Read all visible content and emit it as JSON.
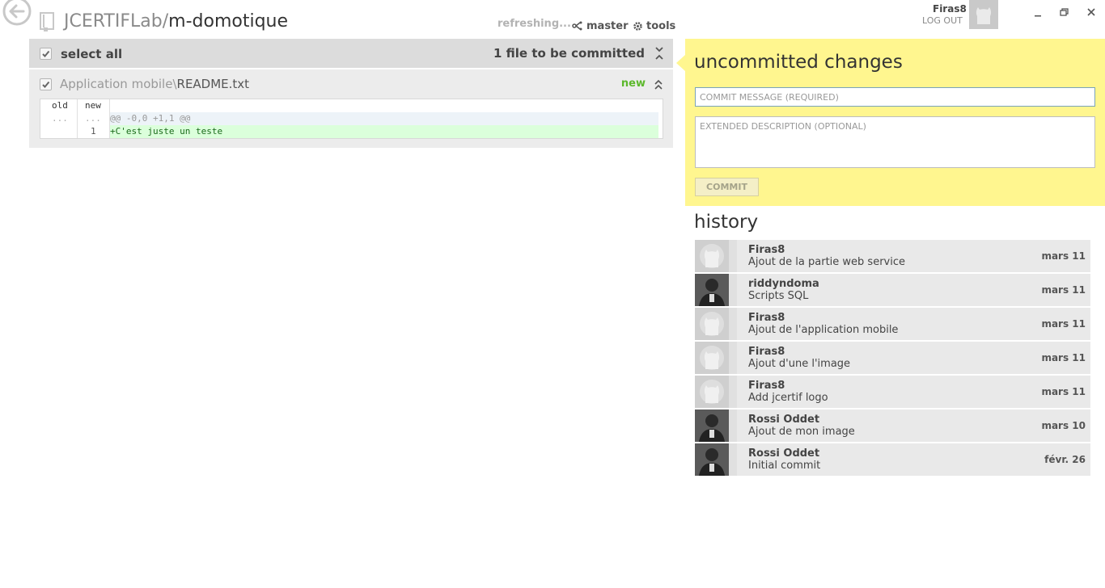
{
  "repo": {
    "owner": "JCERTIFLab",
    "separator": "/",
    "name": "m-domotique"
  },
  "toolbar": {
    "status": "refreshing...",
    "branch": "master",
    "tools": "tools"
  },
  "user": {
    "name": "Firas8",
    "logout": "LOG OUT"
  },
  "changes": {
    "select_all": "select all",
    "count_label": "1 file to be committed",
    "file": {
      "folder": "Application mobile\\",
      "name": "README.txt",
      "status": "new",
      "status_color": "#5cb82c",
      "diff": {
        "old_header": "old",
        "new_header": "new",
        "hunk_old": "...",
        "hunk_new": "...",
        "hunk_text": "@@ -0,0 +1,1 @@",
        "add_line_num": "1",
        "add_text": "+C'est juste un teste"
      }
    }
  },
  "commit_panel": {
    "title": "uncommitted changes",
    "message_placeholder": "COMMIT MESSAGE (REQUIRED)",
    "description_placeholder": "EXTENDED DESCRIPTION (OPTIONAL)",
    "commit_button": "COMMIT",
    "panel_color": "#fff68f"
  },
  "history": {
    "title": "history",
    "items": [
      {
        "author": "Firas8",
        "message": "Ajout de la partie web service",
        "date": "mars 11",
        "avatar": "octocat-icon"
      },
      {
        "author": "riddyndoma",
        "message": "Scripts SQL",
        "date": "mars 11",
        "avatar": "photo"
      },
      {
        "author": "Firas8",
        "message": "Ajout de l'application mobile",
        "date": "mars 11",
        "avatar": "octocat-icon"
      },
      {
        "author": "Firas8",
        "message": "Ajout d'une l'image",
        "date": "mars 11",
        "avatar": "octocat-icon"
      },
      {
        "author": "Firas8",
        "message": "Add jcertif logo",
        "date": "mars 11",
        "avatar": "octocat-icon"
      },
      {
        "author": "Rossi Oddet",
        "message": "Ajout de mon image",
        "date": "mars 10",
        "avatar": "photo"
      },
      {
        "author": "Rossi Oddet",
        "message": "Initial commit",
        "date": "févr. 26",
        "avatar": "photo"
      }
    ]
  }
}
